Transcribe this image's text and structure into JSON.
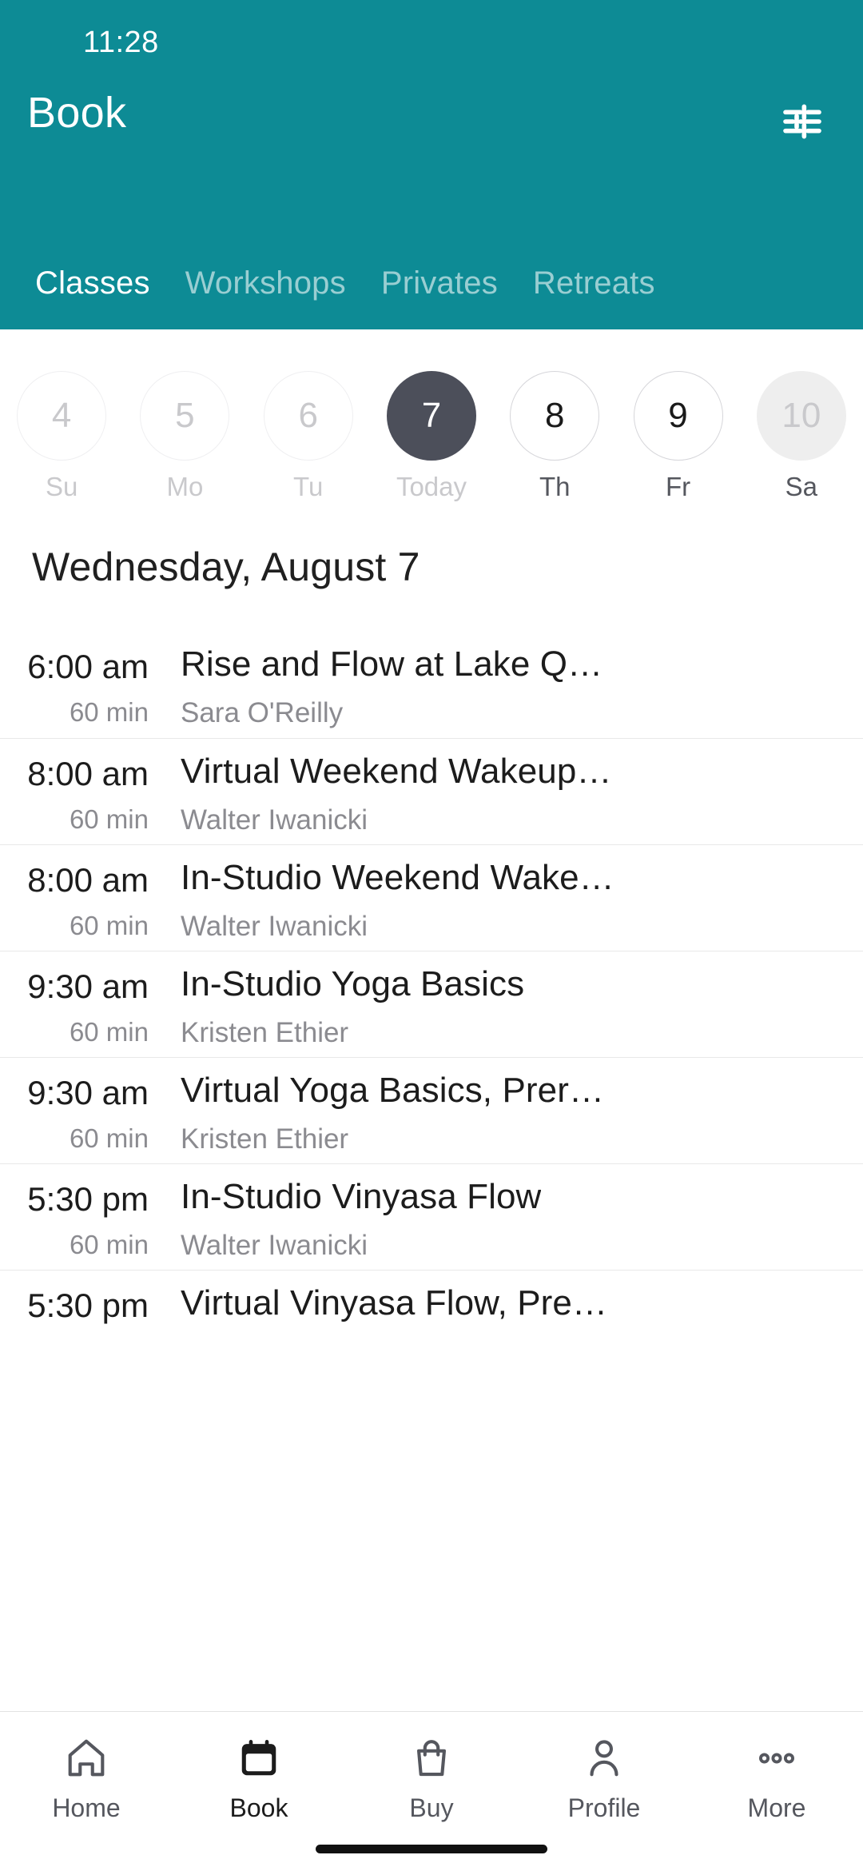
{
  "statusbar": {
    "time": "11:28"
  },
  "header": {
    "title": "Book",
    "filter_icon": "tune-filter-icon",
    "background_color": "#0d8b95",
    "tabs": [
      {
        "label": "Classes",
        "active": true
      },
      {
        "label": "Workshops",
        "active": false
      },
      {
        "label": "Privates",
        "active": false
      },
      {
        "label": "Retreats",
        "active": false
      }
    ]
  },
  "date_strip": {
    "days": [
      {
        "num": "4",
        "label": "Su",
        "state": "past"
      },
      {
        "num": "5",
        "label": "Mo",
        "state": "past"
      },
      {
        "num": "6",
        "label": "Tu",
        "state": "past"
      },
      {
        "num": "7",
        "label": "Today",
        "state": "today"
      },
      {
        "num": "8",
        "label": "Th",
        "state": "future"
      },
      {
        "num": "9",
        "label": "Fr",
        "state": "future"
      },
      {
        "num": "10",
        "label": "Sa",
        "state": "pressed"
      }
    ],
    "selected_color": "#4c4f5a"
  },
  "day_heading": "Wednesday, August 7",
  "classes": [
    {
      "time": "6:00 am",
      "duration": "60 min",
      "title": "Rise and Flow at Lake Q…",
      "instructor": "Sara O'Reilly"
    },
    {
      "time": "8:00 am",
      "duration": "60 min",
      "title": "Virtual Weekend Wakeup…",
      "instructor": "Walter Iwanicki"
    },
    {
      "time": "8:00 am",
      "duration": "60 min",
      "title": "In-Studio Weekend Wake…",
      "instructor": "Walter Iwanicki"
    },
    {
      "time": "9:30 am",
      "duration": "60 min",
      "title": "In-Studio Yoga Basics",
      "instructor": "Kristen Ethier"
    },
    {
      "time": "9:30 am",
      "duration": "60 min",
      "title": "Virtual Yoga Basics, Prer…",
      "instructor": "Kristen Ethier"
    },
    {
      "time": "5:30 pm",
      "duration": "60 min",
      "title": "In-Studio Vinyasa Flow",
      "instructor": "Walter Iwanicki"
    },
    {
      "time": "5:30 pm",
      "duration": "",
      "title": "Virtual Vinyasa Flow, Pre…",
      "instructor": ""
    }
  ],
  "bottom_nav": {
    "items": [
      {
        "label": "Home",
        "icon": "home-icon",
        "active": false
      },
      {
        "label": "Book",
        "icon": "calendar-icon",
        "active": true
      },
      {
        "label": "Buy",
        "icon": "bag-icon",
        "active": false
      },
      {
        "label": "Profile",
        "icon": "person-icon",
        "active": false
      },
      {
        "label": "More",
        "icon": "more-dots-icon",
        "active": false
      }
    ]
  }
}
